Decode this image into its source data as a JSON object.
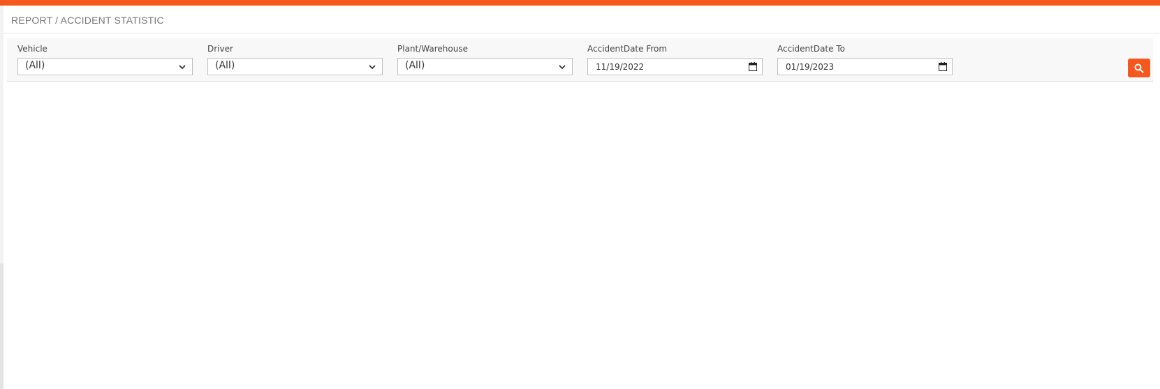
{
  "breadcrumb": "REPORT / ACCIDENT STATISTIC",
  "filters": {
    "vehicle": {
      "label": "Vehicle",
      "value": "(All)"
    },
    "driver": {
      "label": "Driver",
      "value": "(All)"
    },
    "plant": {
      "label": "Plant/Warehouse",
      "value": "(All)"
    },
    "date_from": {
      "label": "AccidentDate From",
      "value": "11/19/2022"
    },
    "date_to": {
      "label": "AccidentDate To",
      "value": "01/19/2023"
    }
  },
  "search_button": {
    "icon": "search-icon"
  },
  "colors": {
    "accent": "#f4581d",
    "panel_bg": "#f8f8f8",
    "breadcrumb_text": "#777777"
  }
}
